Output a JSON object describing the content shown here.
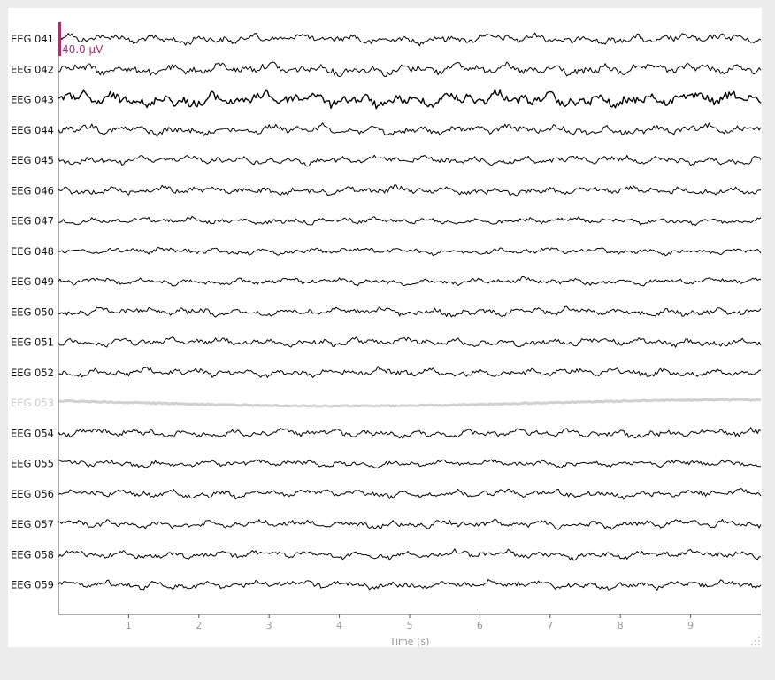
{
  "window": {
    "accent": "#a4306e",
    "background": "#ececec",
    "bad_channel_color": "#d0d0d0"
  },
  "scale_bar": {
    "label": "40.0 µV"
  },
  "chart_data": {
    "type": "line",
    "xlabel": "Time (s)",
    "xlim": [
      0,
      10
    ],
    "ticks": [
      "1",
      "2",
      "3",
      "4",
      "5",
      "6",
      "7",
      "8",
      "9"
    ],
    "channels": [
      {
        "name": "EEG 041",
        "amp": 6,
        "bad": false
      },
      {
        "name": "EEG 042",
        "amp": 7,
        "bad": false
      },
      {
        "name": "EEG 043",
        "amp": 9,
        "bad": false
      },
      {
        "name": "EEG 044",
        "amp": 6,
        "bad": false
      },
      {
        "name": "EEG 045",
        "amp": 5,
        "bad": false
      },
      {
        "name": "EEG 046",
        "amp": 5,
        "bad": false
      },
      {
        "name": "EEG 047",
        "amp": 4,
        "bad": false
      },
      {
        "name": "EEG 048",
        "amp": 4,
        "bad": false
      },
      {
        "name": "EEG 049",
        "amp": 4,
        "bad": false
      },
      {
        "name": "EEG 050",
        "amp": 5,
        "bad": false
      },
      {
        "name": "EEG 051",
        "amp": 5,
        "bad": false
      },
      {
        "name": "EEG 052",
        "amp": 5,
        "bad": false
      },
      {
        "name": "EEG 053",
        "amp": 4,
        "bad": true
      },
      {
        "name": "EEG 054",
        "amp": 5,
        "bad": false
      },
      {
        "name": "EEG 055",
        "amp": 4,
        "bad": false
      },
      {
        "name": "EEG 056",
        "amp": 5,
        "bad": false
      },
      {
        "name": "EEG 057",
        "amp": 5,
        "bad": false
      },
      {
        "name": "EEG 058",
        "amp": 5,
        "bad": false
      },
      {
        "name": "EEG 059",
        "amp": 5,
        "bad": false
      }
    ]
  }
}
